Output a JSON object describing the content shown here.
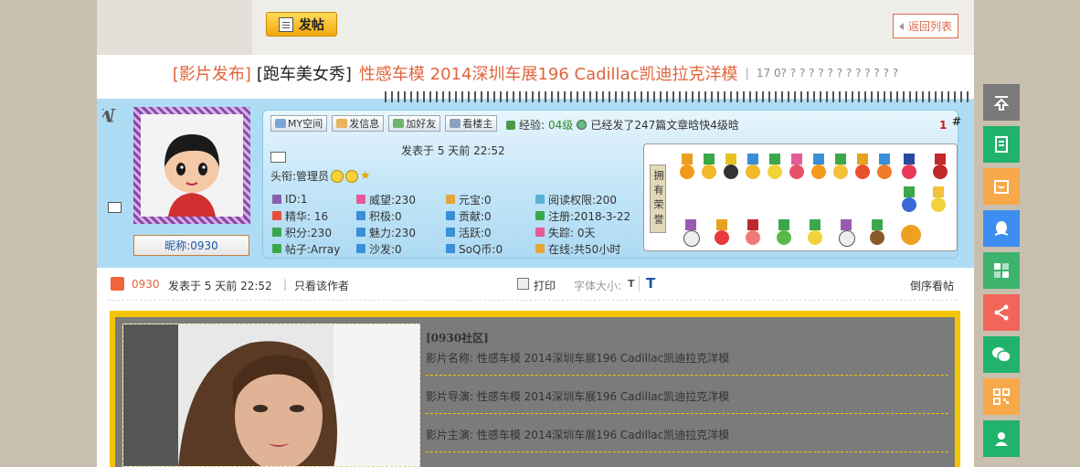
{
  "toolbar": {
    "post_label": "发帖",
    "back_label": "返回列表"
  },
  "title": {
    "category": "[影片发布]",
    "subcategory": "[跑车美女秀]",
    "text": "性感车模 2014深圳车展196 Cadillac凯迪拉克洋模",
    "separator": "|",
    "meta": "17 0? ? ? ? ? ? ? ? ? ? ? ? ?"
  },
  "user": {
    "nickname": "昵称:0930",
    "actions": [
      {
        "label": "MY空间",
        "icon": "home-icon"
      },
      {
        "label": "发信息",
        "icon": "mail-icon"
      },
      {
        "label": "加好友",
        "icon": "add-friend-icon"
      },
      {
        "label": "看楼主",
        "icon": "view-author-icon"
      }
    ],
    "experience_label": "经验:",
    "experience_level": "04级",
    "experience_note": "已经发了247篇文章晗快4级晗",
    "floor_number": "1",
    "floor_hash": "#",
    "posted_time": "发表于 5 天前 22:52",
    "headline": "头衔:管理员",
    "stats": [
      "ID:1",
      "威望:230",
      "元宝:0",
      "阅读权限:200",
      "精华: 16",
      "积极:0",
      "贡献:0",
      "注册:2018-3-22",
      "积分:230",
      "魅力:230",
      "活跃:0",
      "失踪: 0天",
      "帖子:Array",
      "沙发:0",
      "SoQ币:0",
      "在线:共50小时"
    ],
    "medals_label": "拥有荣誉"
  },
  "post_bar": {
    "nickname": "0930",
    "posted": "发表于 5 天前 22:52",
    "separator": "|",
    "only_author": "只看该作者",
    "print": "打印",
    "font_size_label": "字体大小:",
    "font_small": "T",
    "font_big": "T",
    "reverse": "倒序看帖"
  },
  "content": {
    "site_tag": "[0930社区]",
    "lines": [
      "影片名称: 性感车模 2014深圳车展196 Cadillac凯迪拉克洋模",
      "影片导演: 性感车模 2014深圳车展196 Cadillac凯迪拉克洋模",
      "影片主演: 性感车模 2014深圳车展196 Cadillac凯迪拉克洋模"
    ]
  },
  "colors": {
    "accent": "#e0643c",
    "panel_blue": "#aedcf4",
    "content_border": "#f5c400",
    "sidebar_green": "#21b36b",
    "sidebar_orange": "#f7a94a",
    "sidebar_blue": "#3d8ef0",
    "sidebar_red": "#f2665a",
    "sidebar_gray": "#7a7a7a"
  },
  "sidebar": [
    {
      "name": "back-to-top-icon",
      "color": "#7a7a7a"
    },
    {
      "name": "document-icon",
      "color": "#21b36b"
    },
    {
      "name": "calendar-icon",
      "color": "#f7a94a"
    },
    {
      "name": "qq-icon",
      "color": "#3d8ef0"
    },
    {
      "name": "apps-icon",
      "color": "#3db36e"
    },
    {
      "name": "share-icon",
      "color": "#f2665a"
    },
    {
      "name": "wechat-icon",
      "color": "#21b36b"
    },
    {
      "name": "qrcode-icon",
      "color": "#f7a94a"
    },
    {
      "name": "user-icon",
      "color": "#21b36b"
    }
  ]
}
